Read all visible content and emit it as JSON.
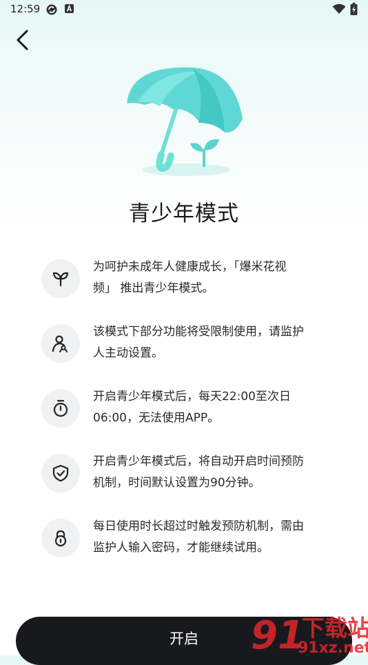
{
  "status_bar": {
    "time": "12:59",
    "icons": [
      "sync-icon",
      "a-badge-icon",
      "wifi-icon",
      "battery-charging-icon"
    ]
  },
  "nav": {
    "back_icon": "chevron-left-icon"
  },
  "hero": {
    "illustration": "umbrella-sprout-illustration"
  },
  "title": "青少年模式",
  "features": [
    {
      "icon": "sprout-icon",
      "line1": "为呵护未成年人健康成长，「爆米花视",
      "line2": "频」 推出青少年模式。"
    },
    {
      "icon": "guardian-icon",
      "line1": "该模式下部分功能将受限制使用，请监护",
      "line2": "人主动设置。"
    },
    {
      "icon": "stopwatch-icon",
      "line1": "开启青少年模式后，每天22:00至次日",
      "line2": "06:00，无法使用APP。"
    },
    {
      "icon": "shield-check-icon",
      "line1": "开启青少年模式后，将自动开启时间预防",
      "line2": "机制，时间默认设置为90分钟。"
    },
    {
      "icon": "lock-icon",
      "line1": "每日使用时长超过时触发预防机制，需由",
      "line2": "监护人输入密码，才能继续试用。"
    }
  ],
  "open_button": "开启",
  "watermark": {
    "logo_text": "91",
    "cn_text": "下载站",
    "url_text": "91xz.net"
  },
  "colors": {
    "accent": "#55d6d4",
    "button": "#18191c",
    "icon_bg": "#f0f1f2",
    "watermark_red": "#e0262a"
  }
}
